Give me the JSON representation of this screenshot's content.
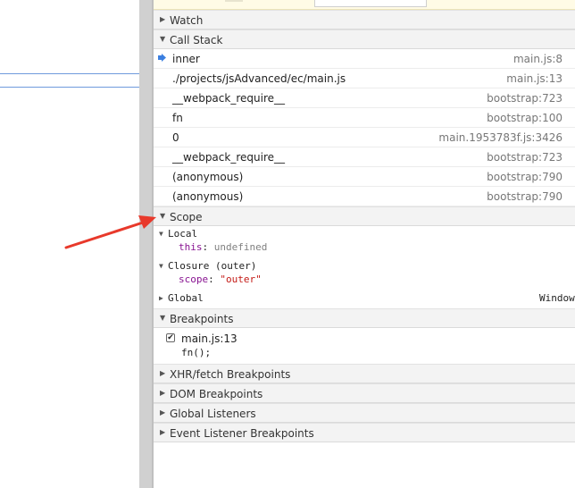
{
  "sections": {
    "watch": "Watch",
    "call_stack": "Call Stack",
    "scope": "Scope",
    "breakpoints": "Breakpoints",
    "xhr": "XHR/fetch Breakpoints",
    "dom": "DOM Breakpoints",
    "global_listeners": "Global Listeners",
    "event_listener": "Event Listener Breakpoints"
  },
  "call_stack": [
    {
      "name": "inner",
      "location": "main.js:8"
    },
    {
      "name": "./projects/jsAdvanced/ec/main.js",
      "location": "main.js:13"
    },
    {
      "name": "__webpack_require__",
      "location": "bootstrap:723"
    },
    {
      "name": "fn",
      "location": "bootstrap:100"
    },
    {
      "name": "0",
      "location": "main.1953783f.js:3426"
    },
    {
      "name": "__webpack_require__",
      "location": "bootstrap:723"
    },
    {
      "name": "(anonymous)",
      "location": "bootstrap:790"
    },
    {
      "name": "(anonymous)",
      "location": "bootstrap:790"
    }
  ],
  "scope": {
    "local_label": "Local",
    "local_prop": "this",
    "local_value": "undefined",
    "closure_label": "Closure (outer)",
    "closure_prop": "scope",
    "closure_value": "\"outer\"",
    "global_label": "Global",
    "global_value": "Window"
  },
  "breakpoints": {
    "file": "main.js:13",
    "code": "fn();",
    "checked": true
  },
  "colors": {
    "arrow": "#e8392b",
    "pointer": "#3b7fe0"
  }
}
